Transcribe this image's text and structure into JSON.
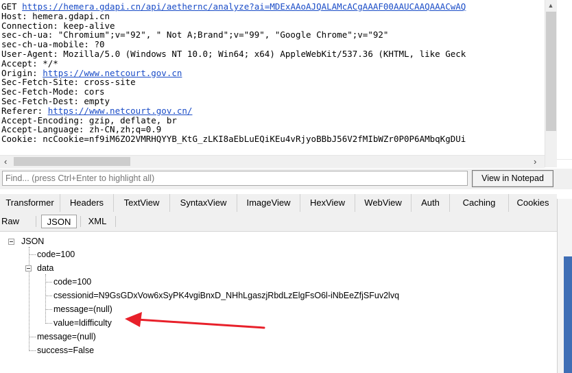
{
  "request": {
    "lines": [
      {
        "label": "GET ",
        "link": "https://hemera.gdapi.cn/api/aethernc/analyze?ai=MDExAAoAJQALAMcACgAAAF00AAUCAAQAAACwAQ"
      },
      {
        "label": "Host: hemera.gdapi.cn",
        "link": ""
      },
      {
        "label": "Connection: keep-alive",
        "link": ""
      },
      {
        "label": "sec-ch-ua: \"Chromium\";v=\"92\", \" Not A;Brand\";v=\"99\", \"Google Chrome\";v=\"92\"",
        "link": ""
      },
      {
        "label": "sec-ch-ua-mobile: ?0",
        "link": ""
      },
      {
        "label": "User-Agent: Mozilla/5.0 (Windows NT 10.0; Win64; x64) AppleWebKit/537.36 (KHTML, like Geck",
        "link": ""
      },
      {
        "label": "Accept: */*",
        "link": ""
      },
      {
        "label": "Origin: ",
        "link": "https://www.netcourt.gov.cn"
      },
      {
        "label": "Sec-Fetch-Site: cross-site",
        "link": ""
      },
      {
        "label": "Sec-Fetch-Mode: cors",
        "link": ""
      },
      {
        "label": "Sec-Fetch-Dest: empty",
        "link": ""
      },
      {
        "label": "Referer: ",
        "link": "https://www.netcourt.gov.cn/"
      },
      {
        "label": "Accept-Encoding: gzip, deflate, br",
        "link": ""
      },
      {
        "label": "Accept-Language: zh-CN,zh;q=0.9",
        "link": ""
      },
      {
        "label": "Cookie: ncCookie=nf9iM6ZO2VMRHQYYB_KtG_zLKI8aEbLuEQiKEu4vRjyoBBbJ56V2fMIbWZr0P0P6AMbqKgDUi",
        "link": ""
      }
    ]
  },
  "find": {
    "placeholder": "Find... (press Ctrl+Enter to highlight all)",
    "notepad_label": "View in Notepad"
  },
  "tabs": [
    "Transformer",
    "Headers",
    "TextView",
    "SyntaxView",
    "ImageView",
    "HexView",
    "WebView",
    "Auth",
    "Caching",
    "Cookies"
  ],
  "subtabs": [
    "Raw",
    "JSON",
    "XML"
  ],
  "selected_subtab": "JSON",
  "tree": {
    "root": "JSON",
    "code": "code=100",
    "data": "data",
    "data_code": "code=100",
    "data_csessionid": "csessionid=N9GsGDxVow6xSyPK4vgiBnxD_NHhLgaszjRbdLzElgFsO6l-iNbEeZfjSFuv2lvq",
    "data_message": "message=(null)",
    "data_value": "value=ldifficulty",
    "message": "message=(null)",
    "success": "success=False"
  },
  "colors": {
    "link": "#1a4cc7",
    "annotation": "#e8202a",
    "panel": "#f0f0f0"
  }
}
